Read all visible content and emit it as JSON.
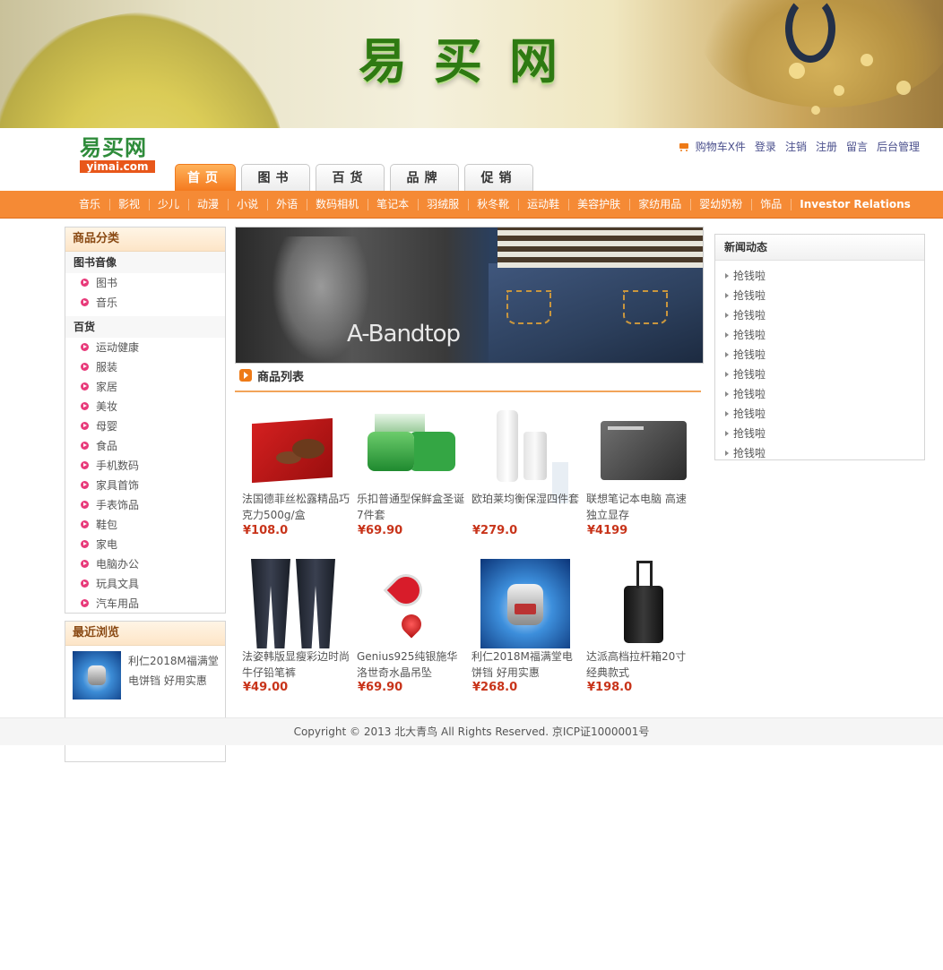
{
  "banner": {
    "title": "易买网"
  },
  "logo": {
    "cn": "易买网",
    "en": "yimai.com"
  },
  "toplinks": {
    "cart": "购物车X件",
    "login": "登录",
    "logout": "注销",
    "register": "注册",
    "message": "留言",
    "admin": "后台管理"
  },
  "tabs": [
    "首页",
    "图书",
    "百货",
    "品牌",
    "促销"
  ],
  "catbar": [
    "音乐",
    "影视",
    "少儿",
    "动漫",
    "小说",
    "外语",
    "数码相机",
    "笔记本",
    "羽绒服",
    "秋冬靴",
    "运动鞋",
    "美容护肤",
    "家纺用品",
    "婴幼奶粉",
    "饰品",
    "Investor Relations"
  ],
  "sidebar": {
    "title": "商品分类",
    "groups": [
      {
        "name": "图书音像",
        "items": [
          "图书",
          "音乐"
        ]
      },
      {
        "name": "百货",
        "items": [
          "运动健康",
          "服装",
          "家居",
          "美妆",
          "母婴",
          "食品",
          "手机数码",
          "家具首饰",
          "手表饰品",
          "鞋包",
          "家电",
          "电脑办公",
          "玩具文具",
          "汽车用品"
        ]
      }
    ]
  },
  "recent": {
    "title": "最近浏览",
    "item": "利仁2018M福满堂电饼铛 好用实惠"
  },
  "hero": {
    "brand": "A-Bandtop"
  },
  "list": {
    "title": "商品列表"
  },
  "products": [
    {
      "name": "法国德菲丝松露精品巧克力500g/盒",
      "price": "¥108.0"
    },
    {
      "name": "乐扣普通型保鲜盒圣诞7件套",
      "price": "¥69.90"
    },
    {
      "name": "欧珀莱均衡保湿四件套",
      "price": "¥279.0"
    },
    {
      "name": "联想笔记本电脑 高速独立显存",
      "price": "¥4199"
    },
    {
      "name": "法姿韩版显瘦彩边时尚牛仔铅笔裤",
      "price": "¥49.00"
    },
    {
      "name": "Genius925纯银施华洛世奇水晶吊坠",
      "price": "¥69.90"
    },
    {
      "name": "利仁2018M福满堂电饼铛 好用实惠",
      "price": "¥268.0"
    },
    {
      "name": "达派高档拉杆箱20寸 经典款式",
      "price": "¥198.0"
    }
  ],
  "news": {
    "title": "新闻动态",
    "items": [
      "抢钱啦",
      "抢钱啦",
      "抢钱啦",
      "抢钱啦",
      "抢钱啦",
      "抢钱啦",
      "抢钱啦",
      "抢钱啦",
      "抢钱啦",
      "抢钱啦"
    ]
  },
  "footer": {
    "text": "Copyright © 2013 北大青鸟 All Rights Reserved. 京ICP证1000001号"
  }
}
